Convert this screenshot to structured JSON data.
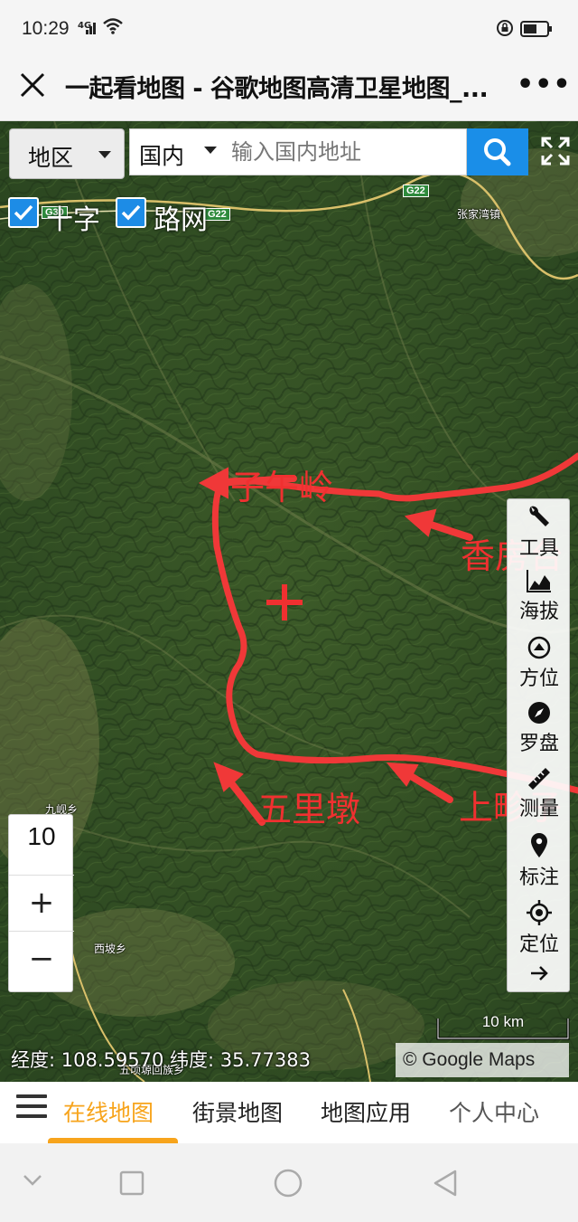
{
  "status_bar": {
    "time": "10:29",
    "network": "4G"
  },
  "title_bar": {
    "title": "一起看地图 - 谷歌地图高清卫星地图_..."
  },
  "map_controls": {
    "region_label": "地区",
    "scope_label": "国内",
    "search_placeholder": "输入国内地址",
    "layers": [
      {
        "label": "十字",
        "checked": true
      },
      {
        "label": "路网",
        "checked": true
      }
    ],
    "zoom_level": "10",
    "zoom_in": "+",
    "zoom_out": "−"
  },
  "tools": [
    {
      "label": "工具",
      "icon": "wrench-icon"
    },
    {
      "label": "海拔",
      "icon": "elevation-icon"
    },
    {
      "label": "方位",
      "icon": "direction-icon"
    },
    {
      "label": "罗盘",
      "icon": "compass-icon"
    },
    {
      "label": "测量",
      "icon": "ruler-icon"
    },
    {
      "label": "标注",
      "icon": "pin-icon"
    },
    {
      "label": "定位",
      "icon": "locate-icon"
    }
  ],
  "map_labels": {
    "highway_g30": "G30",
    "highway_g22_a": "G22",
    "highway_g22_b": "G22",
    "town_zhangjiawan": "张家湾镇",
    "town_jiuxian": "九岘乡",
    "town_xipo": "西坡乡",
    "town_bottom": "五顷塬回族乡"
  },
  "annotations": {
    "zi_wu_ling": "子午岭",
    "xiang_fang_tai": "香房台",
    "wu_li_dun": "五里墩",
    "shang_mao_zi": "上畛子"
  },
  "scale": {
    "label": "10 km"
  },
  "coordinates": {
    "lon_label": "经度:",
    "lon_value": "108.59570",
    "lat_label": "纬度:",
    "lat_value": "35.77383"
  },
  "attribution": "© Google Maps",
  "bottom_nav": {
    "tabs": [
      {
        "label": "在线地图",
        "active": true
      },
      {
        "label": "街景地图",
        "active": false
      },
      {
        "label": "地图应用",
        "active": false
      },
      {
        "label": "个人中心",
        "active": false
      }
    ]
  },
  "colors": {
    "accent": "#f7a41c",
    "search_blue": "#1a8ee8",
    "annotation_red": "#f03030"
  }
}
